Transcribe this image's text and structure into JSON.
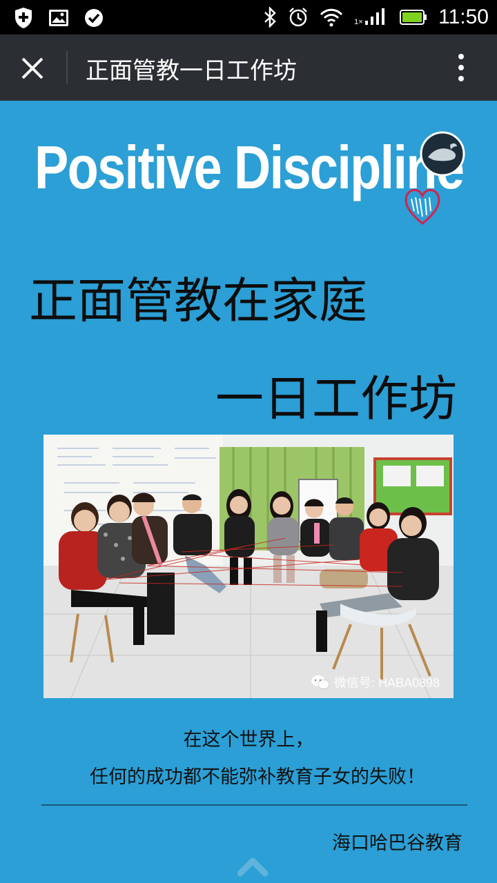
{
  "status_bar": {
    "time": "11:50",
    "network_speed_label": "1×",
    "battery_color": "#7ed321",
    "icons": [
      "shield-plus-icon",
      "image-icon",
      "check-circle-icon",
      "bluetooth-icon",
      "alarm-icon",
      "wifi-icon",
      "signal-icon",
      "battery-icon"
    ]
  },
  "app_bar": {
    "title": "正面管教一日工作坊",
    "close_icon": "close-icon",
    "more_icon": "more-vertical-icon"
  },
  "logo": {
    "text": "Positive Discipline"
  },
  "headline": {
    "line1": "正面管教在家庭",
    "line2": "一日工作坊"
  },
  "photo": {
    "watermark": "微信号: HABA0898"
  },
  "quote": {
    "line1": "在这个世界上，",
    "line2": "任何的成功都不能弥补教育子女的失败！"
  },
  "signature": "海口哈巴谷教育",
  "colors": {
    "background": "#2b9fd6",
    "app_bar": "#2b2f33",
    "status_bar": "#000000"
  }
}
